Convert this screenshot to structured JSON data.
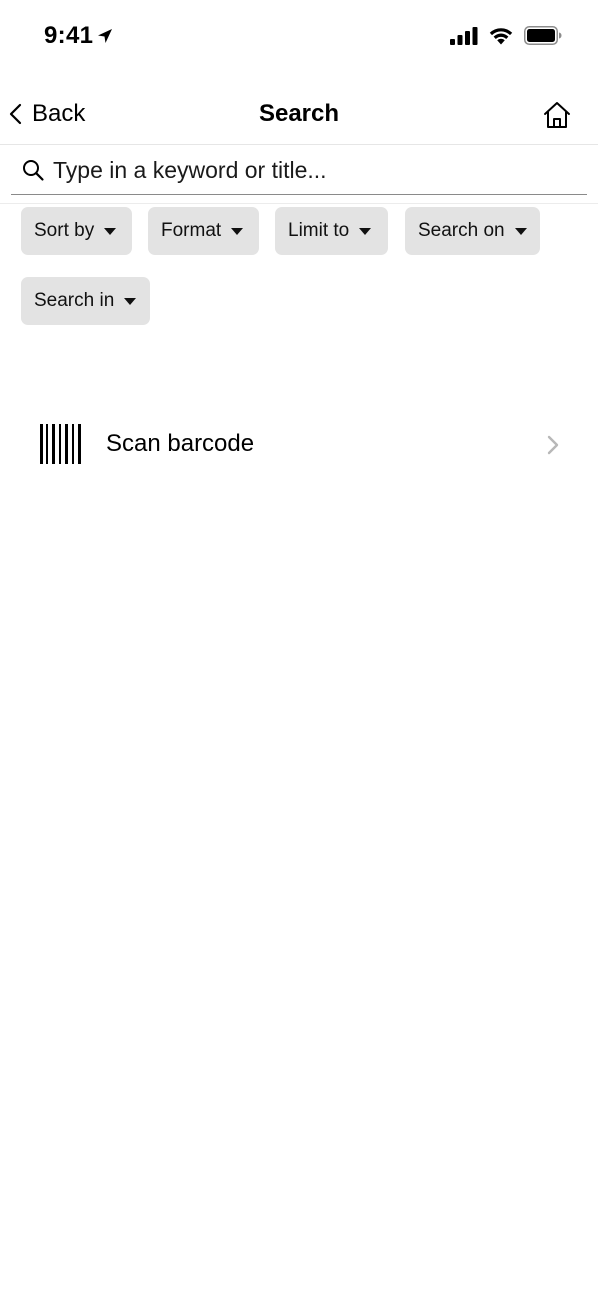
{
  "status_bar": {
    "time": "9:41"
  },
  "nav": {
    "back_label": "Back",
    "title": "Search"
  },
  "search": {
    "placeholder": "Type in a keyword or title...",
    "value": ""
  },
  "filters": [
    {
      "label": "Sort by"
    },
    {
      "label": "Format"
    },
    {
      "label": "Limit to"
    },
    {
      "label": "Search on"
    },
    {
      "label": "Search in"
    }
  ],
  "scan": {
    "label": "Scan barcode"
  },
  "icons": {
    "status": [
      "location-arrow-icon",
      "cellular-signal-icon",
      "wifi-icon",
      "battery-icon"
    ],
    "nav": [
      "chevron-left-icon",
      "home-icon"
    ],
    "search": "search-icon",
    "scan": [
      "barcode-icon",
      "chevron-right-icon"
    ]
  },
  "colors": {
    "chip_bg": "#e3e3e3",
    "text": "#000000",
    "chevron_gray": "#b8b8b8",
    "divider": "#e6e6e6"
  }
}
